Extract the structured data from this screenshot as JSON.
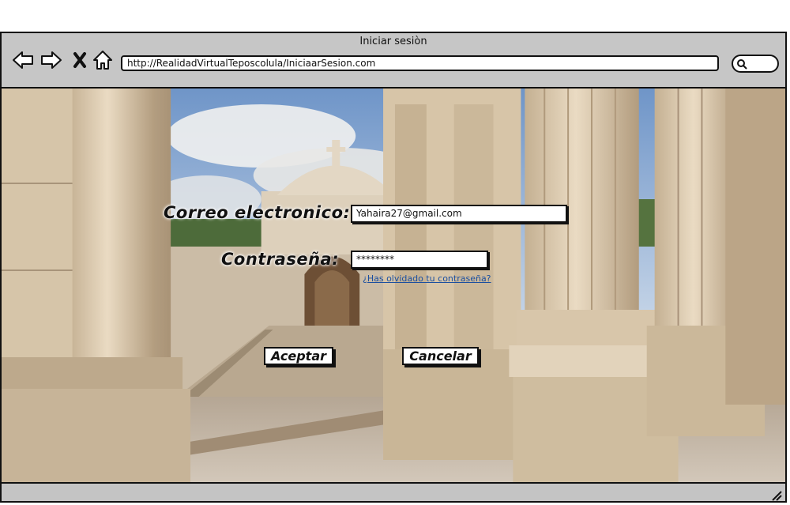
{
  "window": {
    "title": "Iniciar sesiòn"
  },
  "toolbar": {
    "back_icon": "arrow-left-icon",
    "forward_icon": "arrow-right-icon",
    "stop_icon": "close-icon",
    "home_icon": "home-icon",
    "url": "http://RealidadVirtualTeposcolula/IniciaarSesion.com",
    "search_icon": "search-icon"
  },
  "form": {
    "email_label": "Correo electronico:",
    "email_value": "Yahaira27@gmail.com",
    "password_label": "Contraseña:",
    "password_value": "********",
    "forgot_link": "¿Has olvidado tu contraseña?",
    "accept_label": "Aceptar",
    "cancel_label": "Cancelar"
  },
  "background": {
    "description_icon": "monastery-photo"
  },
  "colors": {
    "chrome": "#c6c6c6",
    "link": "#1a4fa0",
    "sky": "#8fb0d6",
    "stone": "#cdb89c"
  }
}
